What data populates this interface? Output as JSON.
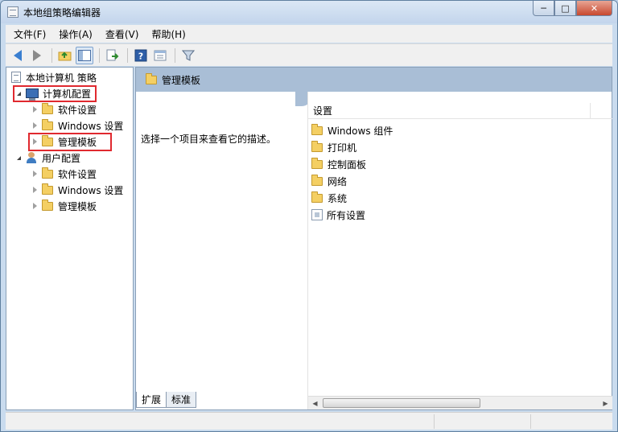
{
  "window": {
    "title": "本地组策略编辑器",
    "controls": {
      "minimize": "─",
      "maximize": "□",
      "close": "✕"
    }
  },
  "menu": [
    "文件(F)",
    "操作(A)",
    "查看(V)",
    "帮助(H)"
  ],
  "toolbar": {
    "icons": [
      "back-icon",
      "forward-icon",
      "up-folder-icon",
      "show-hide-tree-icon",
      "export-list-icon",
      "help-icon",
      "properties-icon",
      "filter-icon"
    ]
  },
  "tree": {
    "root": "本地计算机 策略",
    "computer": "计算机配置",
    "computer_children": [
      "软件设置",
      "Windows 设置",
      "管理模板"
    ],
    "user": "用户配置",
    "user_children": [
      "软件设置",
      "Windows 设置",
      "管理模板"
    ]
  },
  "right": {
    "header": "管理模板",
    "description": "选择一个项目来查看它的描述。",
    "column": "设置",
    "items": [
      "Windows 组件",
      "打印机",
      "控制面板",
      "网络",
      "系统",
      "所有设置"
    ]
  },
  "tabs": [
    "扩展",
    "标准"
  ],
  "colors": {
    "highlight": "#e0292f",
    "header_band": "#a9bed6"
  }
}
